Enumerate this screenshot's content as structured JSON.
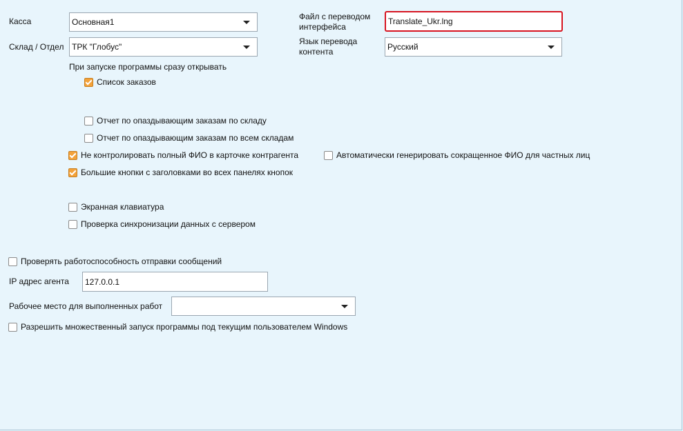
{
  "kassa": {
    "label": "Касса",
    "value": "Основная1"
  },
  "sklad": {
    "label": "Склад / Отдел",
    "value": "ТРК \"Глобус\""
  },
  "translation_file": {
    "label_line1": "Файл с переводом",
    "label_line2": "интерфейса",
    "value": "Translate_Ukr.lng"
  },
  "content_language": {
    "label_line1": "Язык перевода",
    "label_line2": "контента",
    "value": "Русский"
  },
  "startup": {
    "heading": "При запуске программы сразу открывать",
    "orders_list": {
      "label": "Список заказов",
      "checked": true
    },
    "late_orders_warehouse": {
      "label": "Отчет по опаздывающим заказам по складу",
      "checked": false
    },
    "late_orders_all": {
      "label": "Отчет по опаздывающим заказам по всем складам",
      "checked": false
    }
  },
  "options": {
    "no_full_name_control": {
      "label": "Не контролировать полный ФИО в карточке контрагента",
      "checked": true
    },
    "auto_short_name": {
      "label": "Автоматически генерировать сокращенное ФИО для частных лиц",
      "checked": false
    },
    "big_buttons": {
      "label": "Большие кнопки с заголовками во всех панелях кнопок",
      "checked": true
    },
    "screen_keyboard": {
      "label": "Экранная клавиатура",
      "checked": false
    },
    "sync_check": {
      "label": "Проверка синхронизации данных с сервером",
      "checked": false
    }
  },
  "messaging": {
    "check_sending": {
      "label": "Проверять работоспособность отправки сообщений",
      "checked": false
    },
    "ip_label": "IP адрес агента",
    "ip_value": "127.0.0.1"
  },
  "workplace": {
    "label": "Рабочее место для выполненных работ",
    "value": ""
  },
  "multi_launch": {
    "label": "Разрешить множественный запуск программы под текущим пользователем Windows",
    "checked": false
  },
  "colors": {
    "background": "#e8f5fc",
    "checkbox_checked": "#f3a23a",
    "highlight_border": "#d7131f"
  }
}
